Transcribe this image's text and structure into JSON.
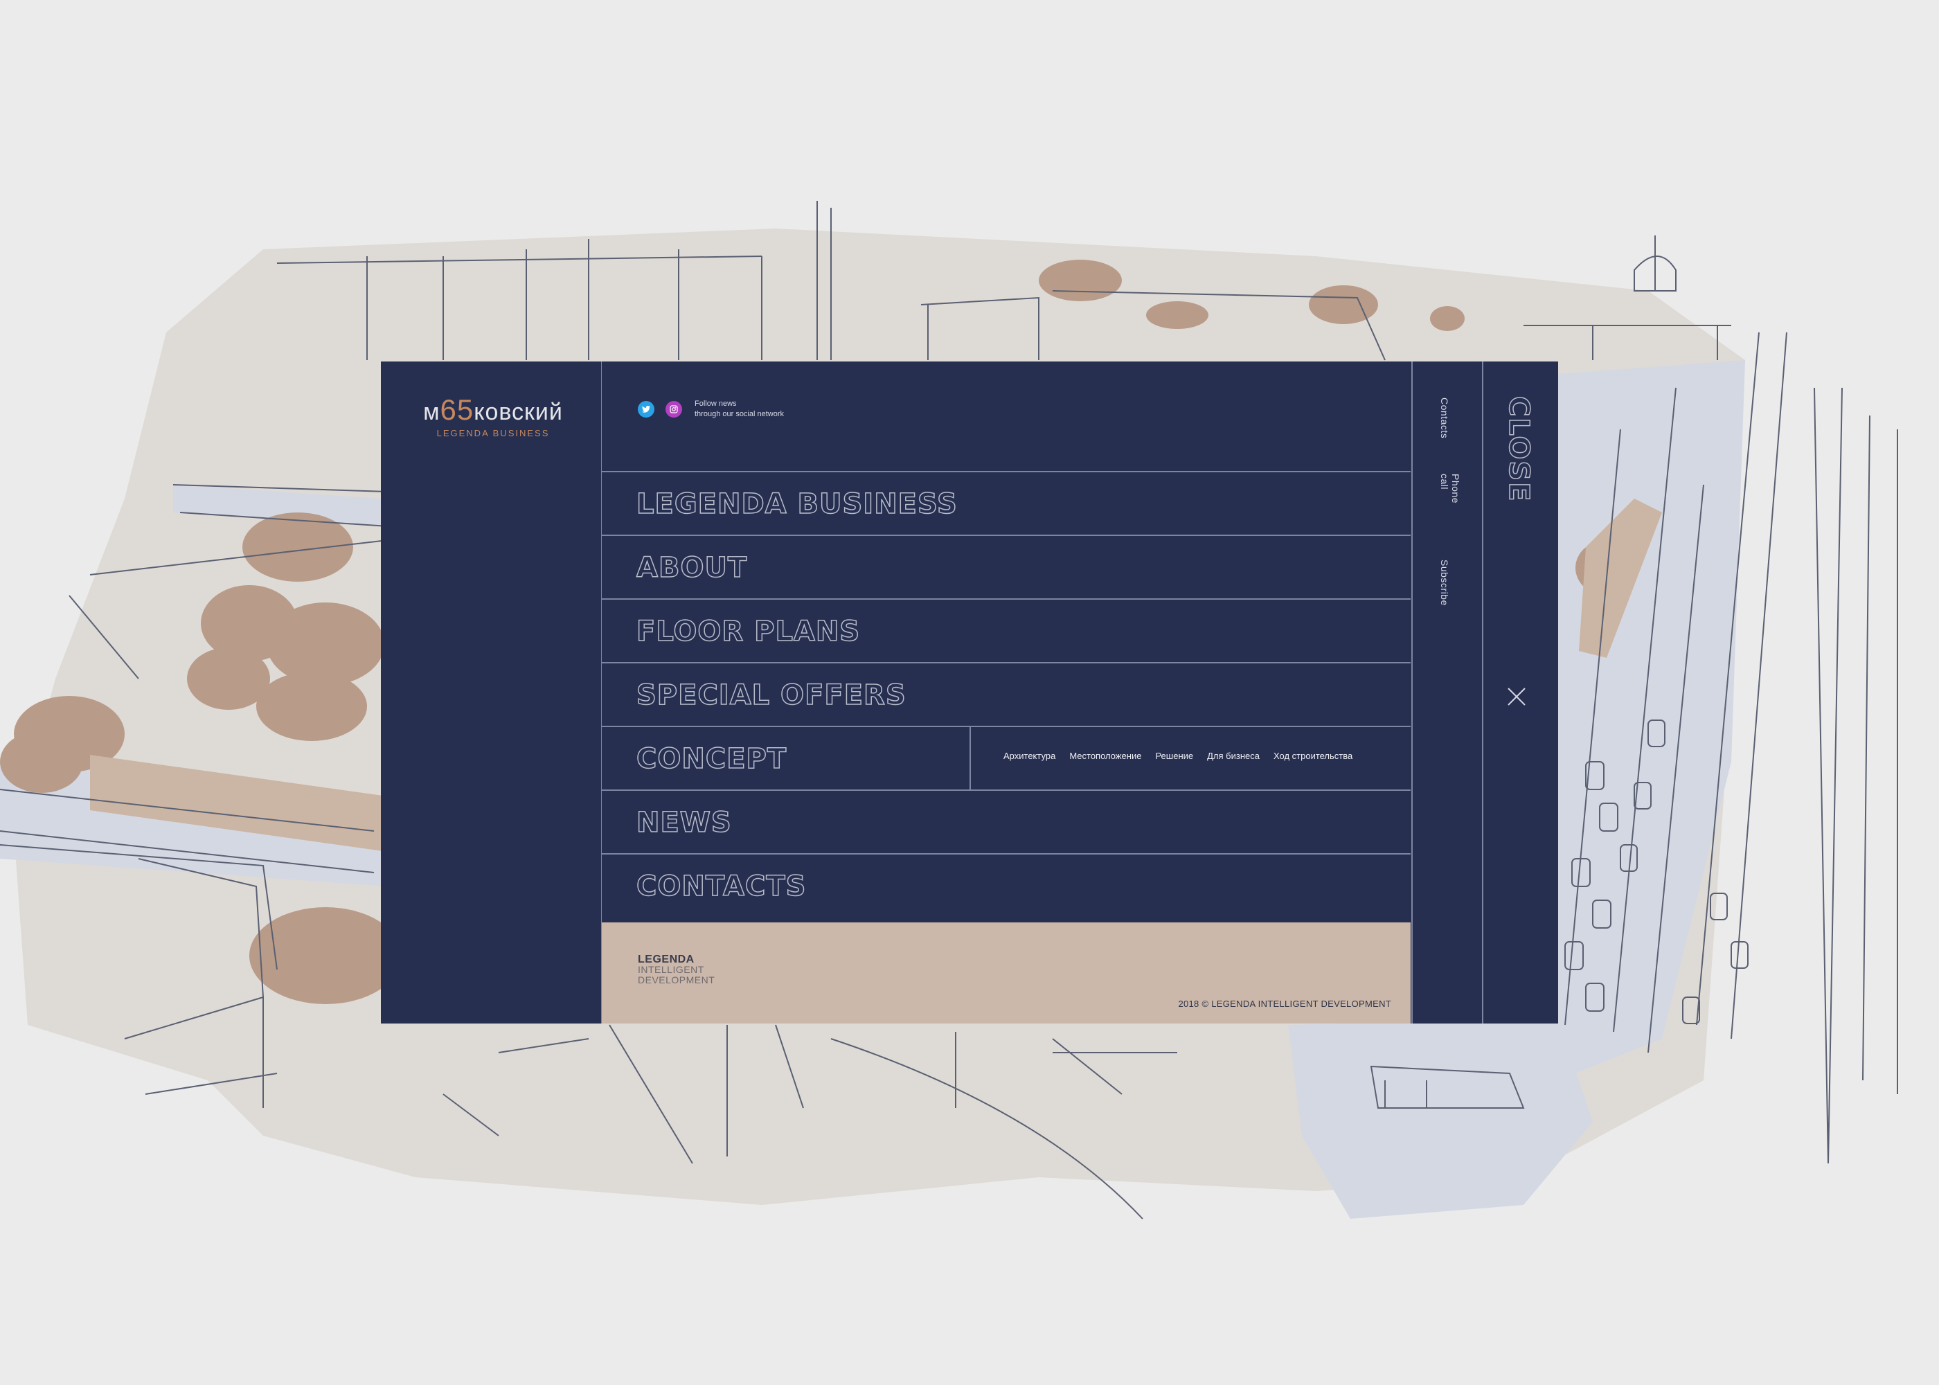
{
  "logo": {
    "word_start": "м",
    "word_num": "65",
    "word_end": "ковский",
    "subtitle": "LEGENDA BUSINESS"
  },
  "social": {
    "icons": [
      "twitter-icon",
      "instagram-icon"
    ],
    "line1": "Follow news",
    "line2": "through our social network"
  },
  "nav": {
    "items": [
      {
        "label": "LEGENDA BUSINESS"
      },
      {
        "label": "ABOUT"
      },
      {
        "label": "FLOOR PLANS"
      },
      {
        "label": "SPECIAL OFFERS"
      },
      {
        "label": "CONCEPT"
      },
      {
        "label": "NEWS"
      },
      {
        "label": "CONTACTS"
      }
    ],
    "concept_links": [
      "Архитектура",
      "Местоположение",
      "Решение",
      "Для бизнеса",
      "Ход строительства"
    ]
  },
  "side": {
    "contacts": "Contacts",
    "phone": "Phone call",
    "subscribe": "Subscribe",
    "close": "CLOSE"
  },
  "footer": {
    "brand_line1": "LEGENDA",
    "brand_line2": "INTELLIGENT",
    "brand_line3": "DEVELOPMENT",
    "copyright": "2018 © LEGENDA INTELLIGENT DEVELOPMENT"
  },
  "colors": {
    "menu_bg": "#262f50",
    "accent": "#c8885e",
    "footer_bg": "#ccb8aa",
    "page_bg": "#ebebeb"
  }
}
